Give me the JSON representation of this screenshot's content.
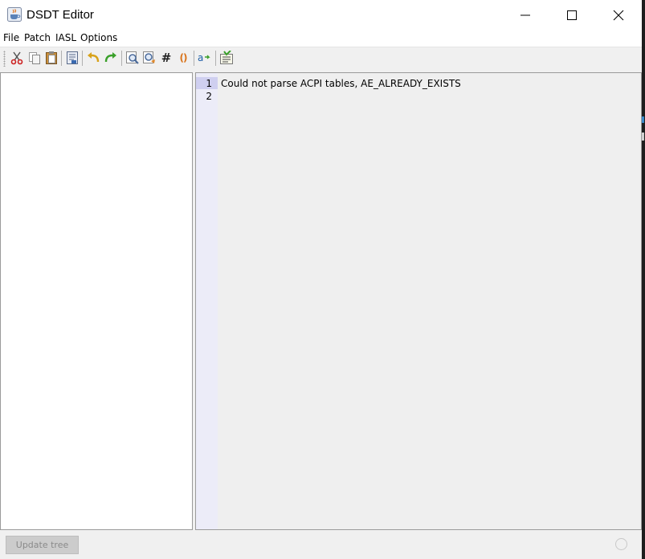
{
  "window": {
    "title": "DSDT Editor",
    "icons": {
      "app": "java-cup-icon",
      "minimize": "minimize-icon",
      "maximize": "maximize-icon",
      "close": "close-icon"
    }
  },
  "menu": {
    "file": "File",
    "patch": "Patch",
    "iasl": "IASL",
    "options": "Options"
  },
  "toolbar": {
    "icons": [
      "cut-icon",
      "copy-icon",
      "paste-icon",
      "save-icon",
      "undo-icon",
      "redo-icon",
      "find-icon",
      "find-replace-icon",
      "hash-icon",
      "braces-icon",
      "autocomplete-icon",
      "compile-icon"
    ],
    "hash_label": "#",
    "braces_label": "()"
  },
  "editor": {
    "line_numbers": [
      "1",
      "2"
    ],
    "lines": [
      "Could not parse ACPI tables, AE_ALREADY_EXISTS",
      ""
    ]
  },
  "status": {
    "update_tree_label": "Update tree"
  },
  "colors": {
    "gutter": "#ececf8",
    "current_line_highlight": "#cfcff0",
    "editor_bg": "#efefef"
  }
}
